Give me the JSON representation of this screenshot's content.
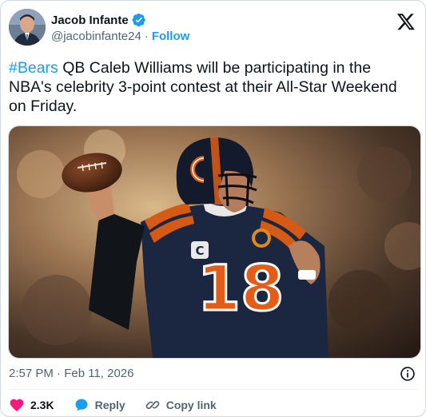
{
  "author": {
    "display_name": "Jacob Infante",
    "handle": "@jacobinfante24",
    "separator": "·",
    "follow_label": "Follow",
    "verified": true
  },
  "tweet": {
    "hashtag": "#Bears",
    "text": " QB Caleb Williams will be participating in the NBA's celebrity 3-point contest at their All-Star Weekend on Friday."
  },
  "media": {
    "jersey_number": "18",
    "captain_letter": "C"
  },
  "meta": {
    "timestamp": "2:57 PM · Feb 11, 2026"
  },
  "actions": {
    "like_count": "2.3K",
    "reply_label": "Reply",
    "copy_link_label": "Copy link"
  },
  "colors": {
    "accent": "#1d9bf0",
    "like": "#f91880",
    "text_primary": "#0f1419",
    "text_secondary": "#536471",
    "bears_navy": "#0b162a",
    "bears_orange": "#c83803"
  },
  "icons": {
    "platform_logo": "x-logo-icon",
    "verified": "verified-badge-icon",
    "info": "info-icon",
    "like": "heart-icon",
    "reply": "reply-bubble-icon",
    "copy_link": "link-icon"
  }
}
